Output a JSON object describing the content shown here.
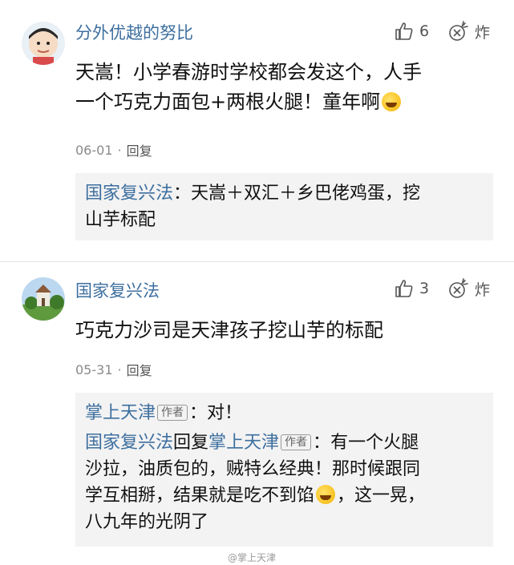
{
  "comments": [
    {
      "username": "分外优越的努比",
      "avatar": "avatar-cartoon",
      "likes": "6",
      "text_line1": "天嵩！小学春游时学校都会发这个，人手",
      "text_line2": "一个巧克力面包+两根火腿！童年啊",
      "date": "06-01",
      "separator": "·",
      "reply_label": "回复",
      "replies": [
        {
          "author": "国家复兴法",
          "colon": "：",
          "line1": "天嵩＋双汇＋乡巴佬鸡蛋，挖",
          "line2": "山芋标配"
        }
      ]
    },
    {
      "username": "国家复兴法",
      "avatar": "avatar-landscape",
      "likes": "3",
      "text_line1": "巧克力沙司是天津孩子挖山芋的标配",
      "date": "05-31",
      "separator": "·",
      "reply_label": "回复",
      "replies": [
        {
          "author": "掌上天津",
          "tag": "作者",
          "colon": "：",
          "text": "对！"
        },
        {
          "author": "国家复兴法",
          "reply_word": "回复",
          "target": "掌上天津",
          "tag": "作者",
          "colon": "：",
          "line1": "有一个火腿",
          "line2": "沙拉，油质包的，贼特么经典！那时候跟同",
          "line3a": "学互相掰，结果就是吃不到馅",
          "line3b": "，这一晃，",
          "line4": "八九年的光阴了"
        }
      ]
    }
  ],
  "watermark": "@掌上天津",
  "colors": {
    "link_blue": "#3d6f9f",
    "reply_bg": "#f3f3f3"
  },
  "icons": [
    "thumbs-up-icon",
    "firecracker-icon",
    "laugh-cry-emoji"
  ]
}
